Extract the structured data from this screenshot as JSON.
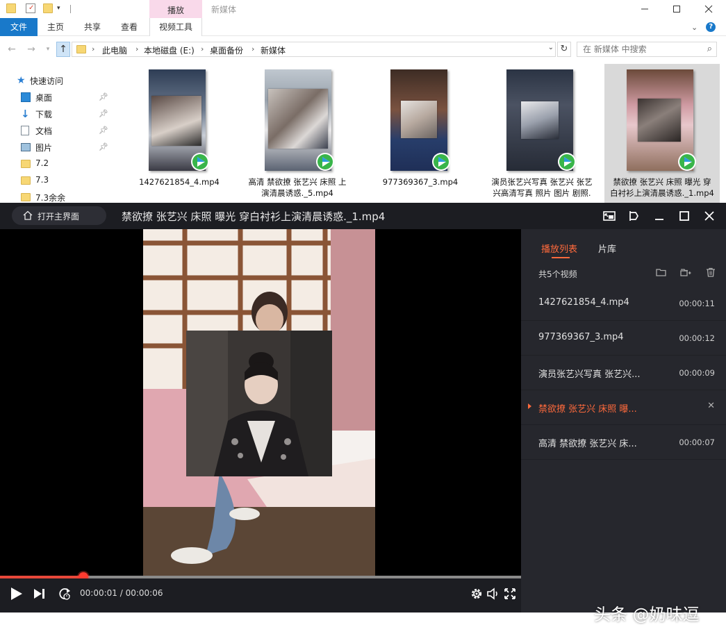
{
  "explorer": {
    "window_title": "新媒体",
    "context_tab_group": "播放",
    "ribbon_tabs": [
      "文件",
      "主页",
      "共享",
      "查看",
      "视频工具"
    ],
    "breadcrumb": [
      "此电脑",
      "本地磁盘 (E:)",
      "桌面备份",
      "新媒体"
    ],
    "search_placeholder": "在 新媒体 中搜索",
    "nav_items": [
      {
        "label": "快速访问",
        "icon": "star-icon"
      },
      {
        "label": "桌面",
        "icon": "desktop-icon",
        "pinned": true
      },
      {
        "label": "下载",
        "icon": "download-icon",
        "pinned": true
      },
      {
        "label": "文档",
        "icon": "document-icon",
        "pinned": true
      },
      {
        "label": "图片",
        "icon": "picture-icon",
        "pinned": true
      },
      {
        "label": "7.2",
        "icon": "folder-icon"
      },
      {
        "label": "7.3",
        "icon": "folder-icon"
      },
      {
        "label": "7.3余余",
        "icon": "folder-icon"
      }
    ],
    "files": [
      {
        "line1": "1427621854_4.mp4",
        "line2": ""
      },
      {
        "line1": "高清 禁欲撩 张艺兴 床照 上",
        "line2": "演清晨诱惑._5.mp4"
      },
      {
        "line1": "977369367_3.mp4",
        "line2": ""
      },
      {
        "line1": "演员张艺兴写真 张艺兴 张艺",
        "line2": "兴高清写真 照片 图片 剧照."
      },
      {
        "line1": "禁欲撩 张艺兴 床照 曝光 穿",
        "line2": "白衬衫上演清晨诱惑._1.mp4",
        "selected": true
      }
    ],
    "colors": {
      "accent": "#1979ca",
      "context_tab": "#f9d9ea",
      "selected_tile": "#d9d9d9"
    }
  },
  "player": {
    "home_button": "打开主界面",
    "title": "禁欲撩 张艺兴 床照 曝光 穿白衬衫上演清晨诱惑._1.mp4",
    "current_time": "00:00:01",
    "separator": " / ",
    "total_time": "00:00:06",
    "progress_fraction": 0.16,
    "tabs": [
      "播放列表",
      "片库"
    ],
    "count_label": "共5个视频",
    "playlist": [
      {
        "name": "1427621854_4.mp4",
        "duration": "00:00:11"
      },
      {
        "name": "977369367_3.mp4",
        "duration": "00:00:12"
      },
      {
        "name": "演员张艺兴写真 张艺兴...",
        "duration": "00:00:09"
      },
      {
        "name": "禁欲撩 张艺兴 床照 曝...",
        "duration": "",
        "active": true
      },
      {
        "name": "高清 禁欲撩 张艺兴 床...",
        "duration": "00:00:07"
      }
    ],
    "colors": {
      "accent": "#ff6a3c",
      "progress": "#e8483a",
      "panel": "#26272d",
      "header": "#1c1d22"
    }
  },
  "watermark": "头条 @奶味逗"
}
